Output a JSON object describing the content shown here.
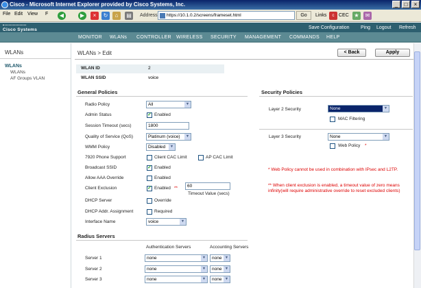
{
  "window": {
    "title": "Cisco - Microsoft Internet Explorer provided by Cisco Systems, Inc."
  },
  "menu": [
    "File",
    "Edit",
    "View",
    "F"
  ],
  "browser": {
    "address_label": "Address",
    "url": "https://10.1.0.2/screens/frameset.html",
    "go": "Go",
    "links": "Links",
    "cec": "CEC"
  },
  "brand": {
    "logo": "Cisco Systems"
  },
  "toplinks": [
    "Save Configuration",
    "Ping",
    "Logout",
    "Refresh"
  ],
  "nav": [
    "MONITOR",
    "WLANs",
    "CONTROLLER",
    "WIRELESS",
    "SECURITY",
    "MANAGEMENT",
    "COMMANDS",
    "HELP"
  ],
  "sidebar": {
    "title": "WLANs",
    "heading": "WLANs",
    "items": [
      "WLANs",
      "AF Groups VLAN"
    ]
  },
  "page": {
    "breadcrumb": "WLANs > Edit",
    "back": "< Back",
    "apply": "Apply"
  },
  "wlan": {
    "id_label": "WLAN ID",
    "id": "2",
    "ssid_label": "WLAN SSID",
    "ssid": "voice"
  },
  "general": {
    "title": "General Policies",
    "radio_policy_label": "Radio Policy",
    "radio_policy": "All",
    "admin_status_label": "Admin Status",
    "admin_status": "Enabled",
    "session_timeout_label": "Session Timeout (secs)",
    "session_timeout": "1800",
    "qos_label": "Quality of Service (QoS)",
    "qos": "Platinum (voice)",
    "wmm_label": "WMM Policy",
    "wmm": "Disabled",
    "phone_label": "7920 Phone Support",
    "client_cac": "Client CAC Limit",
    "ap_cac": "AP CAC Limit",
    "broadcast_label": "Broadcast SSID",
    "broadcast": "Enabled",
    "aaa_label": "Allow AAA Override",
    "aaa": "Enabled",
    "exclusion_label": "Client Exclusion",
    "exclusion": "Enabled",
    "exclusion_mark": "**",
    "timeout_value": "60",
    "timeout_label": "Timeout Value (secs)",
    "dhcp_server_label": "DHCP Server",
    "dhcp_override": "Override",
    "dhcp_assign_label": "DHCP Addr. Assignment",
    "dhcp_required": "Required",
    "iface_label": "Interface Name",
    "iface": "voice"
  },
  "security": {
    "title": "Security Policies",
    "l2_label": "Layer 2 Security",
    "l2": "None",
    "mac_filter": "MAC Filtering",
    "l3_label": "Layer 3 Security",
    "l3": "None",
    "web_policy": "Web Policy",
    "web_mark": "*"
  },
  "notes": {
    "n1": "* Web Policy cannot be used in combination with IPsec and L2TP.",
    "n2": "** When client exclusion is enabled, a timeout value of zero means infinity(will require administrative override to reset excluded clients)"
  },
  "radius": {
    "title": "Radius Servers",
    "auth_header": "Authentication Servers",
    "acct_header": "Accounting Servers",
    "servers": [
      {
        "label": "Server 1",
        "auth": "none",
        "acct": "none"
      },
      {
        "label": "Server 2",
        "auth": "none",
        "acct": "none"
      },
      {
        "label": "Server 3",
        "auth": "none",
        "acct": "none"
      }
    ]
  },
  "colors": {
    "nav": "#5c8a93",
    "header": "#2d5f6f",
    "selected": "#0a246a",
    "note": "#dd0000"
  }
}
